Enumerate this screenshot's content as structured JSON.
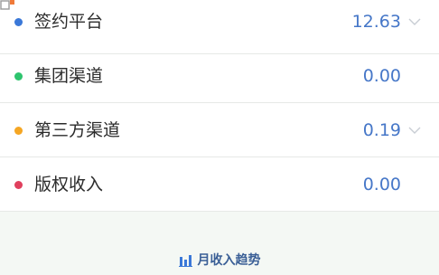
{
  "colors": {
    "accent_value": "#4677c8",
    "dot_blue": "#3a78d8",
    "dot_green": "#2ec46e",
    "dot_orange": "#f5a623",
    "dot_red": "#e0405e",
    "trend_title": "#3a5f96"
  },
  "rows": [
    {
      "label": "签约平台",
      "value": "12.63",
      "dot_color": "#3a78d8",
      "chevron": true
    },
    {
      "label": "集团渠道",
      "value": "0.00",
      "dot_color": "#2ec46e",
      "chevron": false
    },
    {
      "label": "第三方渠道",
      "value": "0.19",
      "dot_color": "#f5a623",
      "chevron": true
    },
    {
      "label": "版权收入",
      "value": "0.00",
      "dot_color": "#e0405e",
      "chevron": false
    }
  ],
  "trend": {
    "title": "月收入趋势",
    "icon": "bar-chart-icon"
  },
  "corner_icon": "copy-icon"
}
